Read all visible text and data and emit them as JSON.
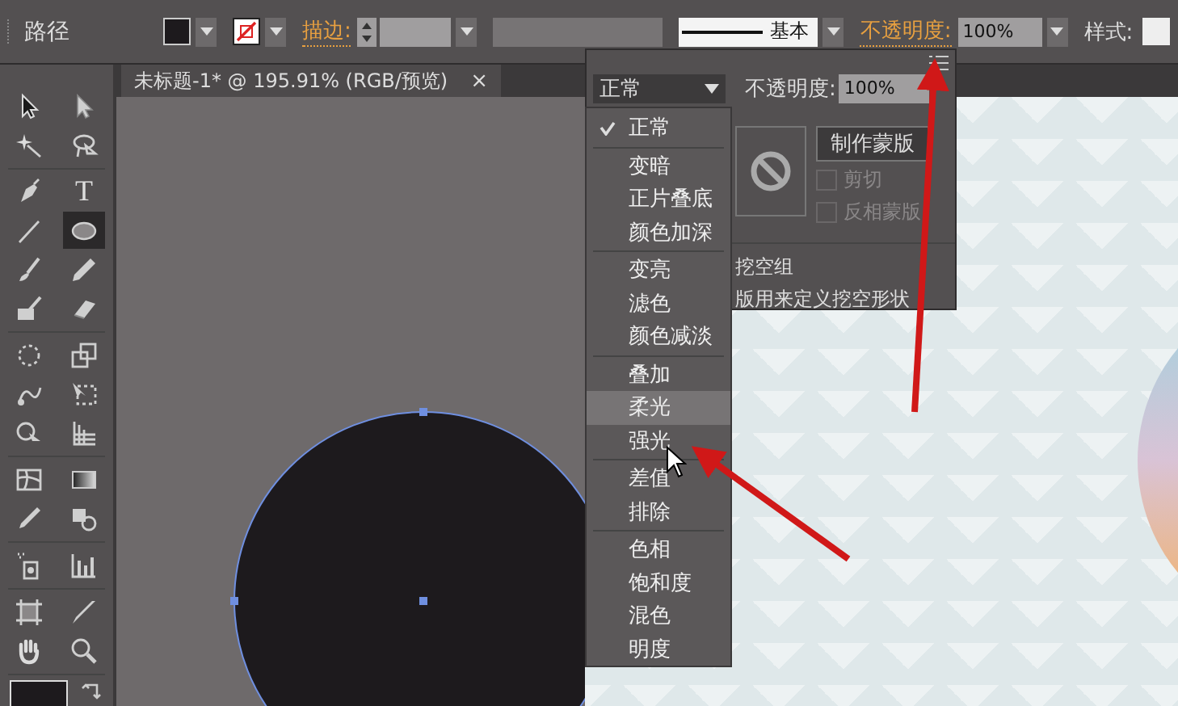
{
  "control_bar": {
    "object_type": "路径",
    "stroke_label": "描边:",
    "stroke_profile": "基本",
    "opacity_label": "不透明度:",
    "opacity_value": "100%",
    "style_label": "样式:"
  },
  "tool_groups": [
    {
      "tools": [
        {
          "kind": "selection",
          "selected": false
        },
        {
          "kind": "direct",
          "selected": false
        },
        {
          "kind": "wand",
          "selected": false
        },
        {
          "kind": "lasso",
          "selected": false
        }
      ]
    },
    {
      "tools": [
        {
          "kind": "pen",
          "selected": false
        },
        {
          "kind": "type",
          "glyph": "T",
          "selected": false
        },
        {
          "kind": "line",
          "selected": false
        },
        {
          "kind": "ellipse",
          "selected": true
        },
        {
          "kind": "brush",
          "selected": false
        },
        {
          "kind": "pencil",
          "selected": false
        },
        {
          "kind": "blob",
          "selected": false
        },
        {
          "kind": "eraser",
          "selected": false
        }
      ]
    },
    {
      "tools": [
        {
          "kind": "rotate",
          "selected": false
        },
        {
          "kind": "scale",
          "selected": false
        },
        {
          "kind": "warp",
          "selected": false
        },
        {
          "kind": "free",
          "selected": false
        },
        {
          "kind": "builder",
          "selected": false
        },
        {
          "kind": "grid",
          "selected": false
        }
      ]
    },
    {
      "tools": [
        {
          "kind": "mesh",
          "selected": false
        },
        {
          "kind": "gradient",
          "selected": false
        },
        {
          "kind": "dropper",
          "selected": false
        },
        {
          "kind": "blend",
          "selected": false
        }
      ]
    },
    {
      "tools": [
        {
          "kind": "spray",
          "selected": false
        },
        {
          "kind": "graph",
          "selected": false
        }
      ]
    },
    {
      "tools": [
        {
          "kind": "artboard",
          "selected": false
        },
        {
          "kind": "knife",
          "selected": false
        },
        {
          "kind": "hand",
          "selected": false
        },
        {
          "kind": "zoom",
          "selected": false
        }
      ]
    }
  ],
  "document_tab": {
    "title": "未标题-1* @ 195.91% (RGB/预览)",
    "close": "×"
  },
  "transparency_panel": {
    "blend_mode": "正常",
    "opacity_label": "不透明度:",
    "opacity_value": "100%",
    "make_mask_button": "制作蒙版",
    "clip": {
      "label": "剪切",
      "checked": false,
      "disabled": true
    },
    "invert_mask": {
      "label": "反相蒙版",
      "checked": false,
      "disabled": true
    },
    "knockout_group": "挖空组",
    "opacity_mask_text": "版用来定义挖空形状"
  },
  "blend_menu": {
    "groups": [
      {
        "items": [
          {
            "label": "正常",
            "checked": true,
            "hovered": false
          }
        ]
      },
      {
        "items": [
          {
            "label": "变暗",
            "checked": false,
            "hovered": false
          },
          {
            "label": "正片叠底",
            "checked": false,
            "hovered": false
          },
          {
            "label": "颜色加深",
            "checked": false,
            "hovered": false
          }
        ]
      },
      {
        "items": [
          {
            "label": "变亮",
            "checked": false,
            "hovered": false
          },
          {
            "label": "滤色",
            "checked": false,
            "hovered": false
          },
          {
            "label": "颜色减淡",
            "checked": false,
            "hovered": false
          }
        ]
      },
      {
        "items": [
          {
            "label": "叠加",
            "checked": false,
            "hovered": false
          },
          {
            "label": "柔光",
            "checked": false,
            "hovered": true
          },
          {
            "label": "强光",
            "checked": false,
            "hovered": false
          }
        ]
      },
      {
        "items": [
          {
            "label": "差值",
            "checked": false,
            "hovered": false
          },
          {
            "label": "排除",
            "checked": false,
            "hovered": false
          }
        ]
      },
      {
        "items": [
          {
            "label": "色相",
            "checked": false,
            "hovered": false
          },
          {
            "label": "饱和度",
            "checked": false,
            "hovered": false
          },
          {
            "label": "混色",
            "checked": false,
            "hovered": false
          },
          {
            "label": "明度",
            "checked": false,
            "hovered": false
          }
        ]
      }
    ]
  }
}
